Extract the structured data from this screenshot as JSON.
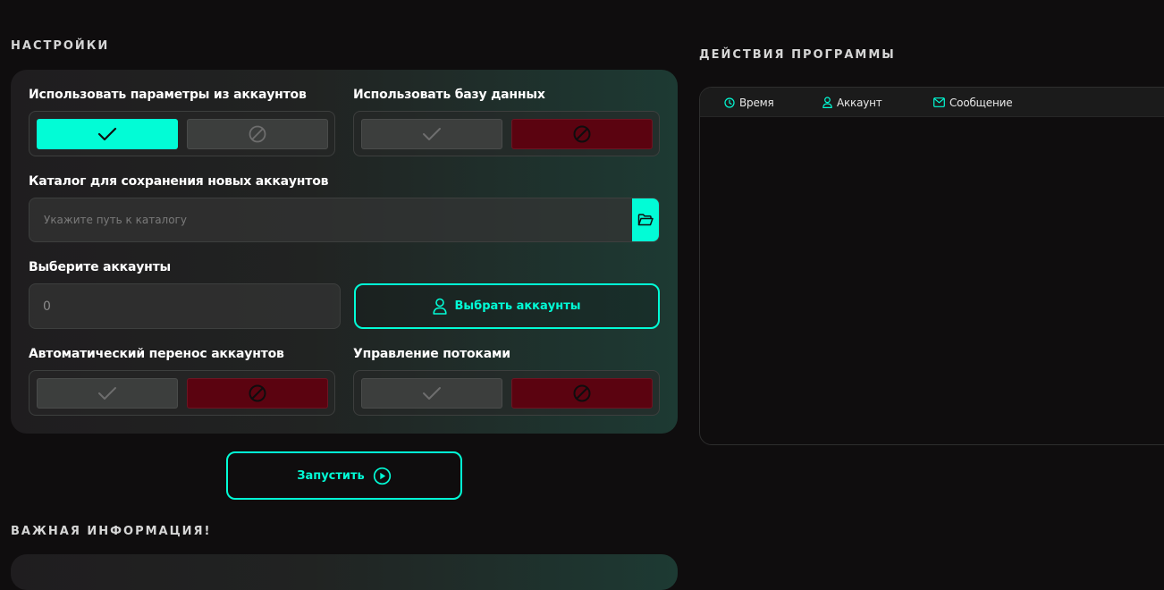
{
  "settings": {
    "title": "НАСТРОЙКИ",
    "use_account_params": {
      "label": "Использовать параметры из аккаунтов",
      "state": "yes"
    },
    "use_database": {
      "label": "Использовать базу данных",
      "state": "no"
    },
    "save_directory": {
      "label": "Каталог для сохранения новых аккаунтов",
      "placeholder": "Укажите путь к каталогу",
      "value": "",
      "button_icon": "folder-open-icon"
    },
    "select_accounts": {
      "label": "Выберите аккаунты",
      "count": "0",
      "button_label": "Выбрать аккаунты",
      "button_icon": "user-icon"
    },
    "auto_transfer": {
      "label": "Автоматический перенос аккаунтов",
      "state": "no"
    },
    "thread_control": {
      "label": "Управление потоками",
      "state": "no"
    },
    "toggle_icons": {
      "yes": "check-icon",
      "no": "ban-icon"
    },
    "colors": {
      "accent": "#02fcd6",
      "danger": "#5b0310"
    }
  },
  "start": {
    "label": "Запустить",
    "icon": "play-circle-icon"
  },
  "info": {
    "title": "ВАЖНАЯ ИНФОРМАЦИЯ!"
  },
  "log": {
    "title": "ДЕЙСТВИЯ ПРОГРАММЫ",
    "columns": [
      {
        "label": "Время",
        "icon": "clock-icon"
      },
      {
        "label": "Аккаунт",
        "icon": "user-icon"
      },
      {
        "label": "Сообщение",
        "icon": "mail-icon"
      }
    ],
    "rows": []
  }
}
